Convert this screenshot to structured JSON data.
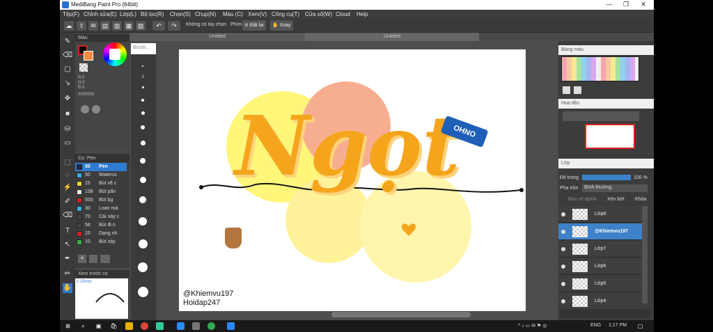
{
  "window": {
    "title": "MediBang Paint Pro (64bit)"
  },
  "menu": [
    "Tệp(F)",
    "Chỉnh sửa(E)",
    "Lớp(L)",
    "Bộ lọc(R)",
    "Chọn(S)",
    "Chụp(N)",
    "Màu (C)",
    "Xem(V)",
    "Công cụ(T)",
    "Cửa sổ(W)",
    "Cloud",
    "Help"
  ],
  "toolbar": {
    "no_option": "Không có tùy chọn",
    "key_label": "Phím",
    "reset_label": "Đặt lại",
    "rotate_label": "Xoay"
  },
  "tabs": [
    "Untitled",
    "Untitled"
  ],
  "color_panel": {
    "title": "Màu",
    "r": "R:0",
    "g": "G:0",
    "b": "B:0",
    "hex": "#000000"
  },
  "brush_panel": {
    "title": "Cọ: Pen",
    "items": [
      {
        "size": "50",
        "name": "Pen",
        "color": "#1b2a4a",
        "selected": true
      },
      {
        "size": "50",
        "name": "Waterco",
        "color": "#3ab0e0"
      },
      {
        "size": "15",
        "name": "Bút vẽ c",
        "color": "#e8d23a"
      },
      {
        "size": "138",
        "name": "Bút pấn",
        "color": "#e8e8e8"
      },
      {
        "size": "500",
        "name": "Bút bg",
        "color": "#d22222"
      },
      {
        "size": "30",
        "name": "Loan mà",
        "color": "#3ab0e0"
      },
      {
        "size": "70",
        "name": "Cái này c",
        "color": "#444444"
      },
      {
        "size": "58",
        "name": "Bút đi n",
        "color": "#444444"
      },
      {
        "size": "15",
        "name": "Dạng nh",
        "color": "#d22222"
      },
      {
        "size": "10",
        "name": "Bút này",
        "color": "#3cb043"
      }
    ]
  },
  "preview": {
    "title": "Xem trước cọ",
    "size": "0.25mm"
  },
  "brush_sizes": {
    "title": "Brush...",
    "values": [
      "1",
      "2",
      "3",
      "4",
      "5",
      "7",
      "10",
      "12",
      "15",
      "20",
      "25",
      "30",
      "40",
      "50"
    ]
  },
  "canvas": {
    "lettering": "Ngọt",
    "credit_1": "@Khiemvu197",
    "credit_2": "Hoidap247",
    "sticker_text": "OHNO"
  },
  "palette_panel": {
    "title": "Bảng màu"
  },
  "navigator": {
    "title": "Hoa tiêu"
  },
  "layers": {
    "title": "Lớp",
    "opacity_label": "Độ trong",
    "opacity_value": "100 %",
    "blend_label": "Pha trộn",
    "blend_value": "Bình thường",
    "protect_alpha": "Bảo vệ alpha",
    "clip": "Xén bớt",
    "lock": "Khóa",
    "items": [
      {
        "name": "Lớp8",
        "selected": false
      },
      {
        "name": "@Khiemvu197",
        "selected": true
      },
      {
        "name": "Lớp7",
        "selected": false
      },
      {
        "name": "Lớp6",
        "selected": false
      },
      {
        "name": "Lớp5",
        "selected": false
      },
      {
        "name": "Lớp4",
        "selected": false
      }
    ]
  },
  "taskbar": {
    "lang": "ENG",
    "time": "1:17 PM"
  },
  "colors": {
    "accent": "#2f7bd1",
    "yellow": "#fff36e",
    "salmon": "#f6a88a",
    "orange": "#f5a51c"
  }
}
